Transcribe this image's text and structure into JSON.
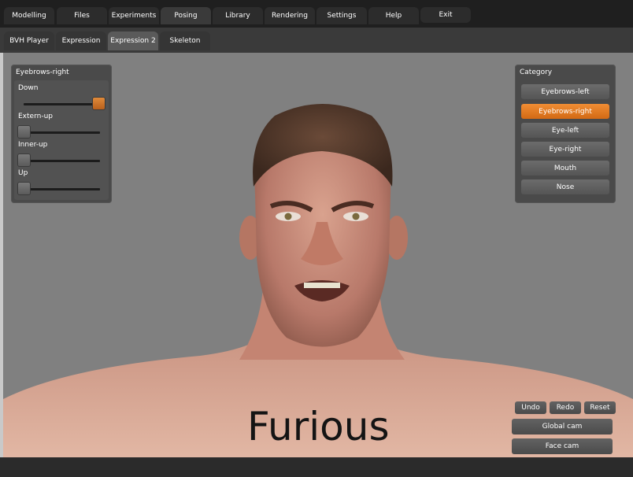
{
  "main_tabs": [
    "Modelling",
    "Files",
    "Experiments",
    "Posing",
    "Library",
    "Rendering",
    "Settings",
    "Help",
    "Exit"
  ],
  "active_main_tab": "Posing",
  "sub_tabs": [
    "BVH Player",
    "Expression",
    "Expression 2",
    "Skeleton"
  ],
  "active_sub_tab": "Expression 2",
  "sliders_panel": {
    "title": "Eyebrows-right",
    "sliders": [
      {
        "label": "Down",
        "value": 1.0
      },
      {
        "label": "Extern-up",
        "value": 0.0
      },
      {
        "label": "Inner-up",
        "value": 0.0
      },
      {
        "label": "Up",
        "value": 0.0
      }
    ]
  },
  "category_panel": {
    "title": "Category",
    "items": [
      "Eyebrows-left",
      "Eyebrows-right",
      "Eye-left",
      "Eye-right",
      "Mouth",
      "Nose"
    ],
    "selected": "Eyebrows-right"
  },
  "actions": {
    "undo": "Undo",
    "redo": "Redo",
    "reset": "Reset",
    "global_cam": "Global cam",
    "face_cam": "Face cam"
  },
  "caption": "Furious",
  "colors": {
    "accent": "#e07a24",
    "viewport": "#808080",
    "toolbar": "#1f1f1f"
  }
}
